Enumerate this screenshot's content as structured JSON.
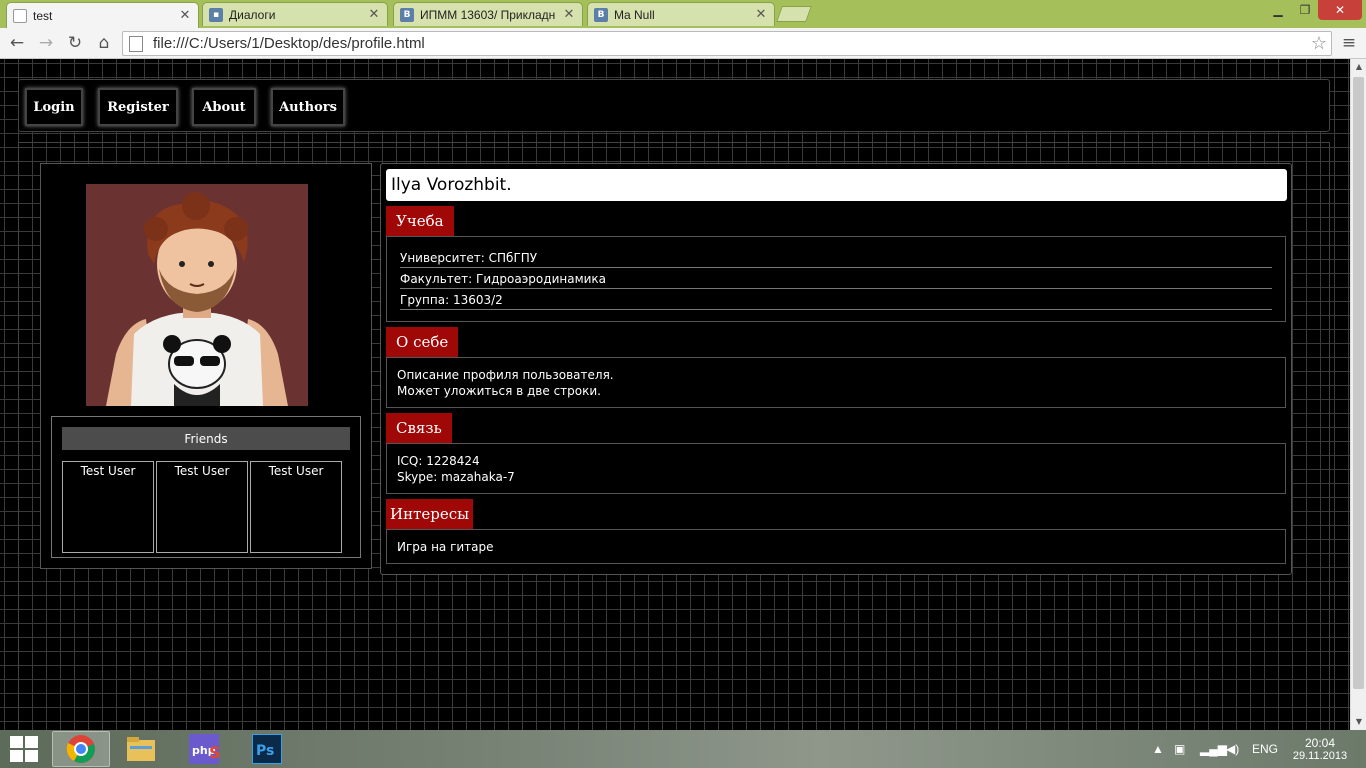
{
  "browser": {
    "tabs": [
      {
        "title": "test",
        "active": true
      },
      {
        "title": "Диалоги",
        "active": false
      },
      {
        "title": "ИПММ 13603/ Прикладн",
        "active": false
      },
      {
        "title": "Ma Null",
        "active": false
      }
    ],
    "address": "file:///C:/Users/1/Desktop/des/profile.html"
  },
  "nav": {
    "buttons": [
      "Login",
      "Register",
      "About",
      "Authors"
    ]
  },
  "profile": {
    "name": "Ilya Vorozhbit.",
    "friends_title": "Friends",
    "friends": [
      "Test User",
      "Test User",
      "Test User"
    ],
    "sections": {
      "study": {
        "title": "Учеба",
        "lines": [
          "Университет: СПбГПУ",
          "Факультет: Гидроаэродинамика",
          "Группа: 13603/2"
        ]
      },
      "about": {
        "title": "О себе",
        "lines": [
          "Описание профиля пользователя.",
          "Может уложиться в две строки."
        ]
      },
      "contact": {
        "title": "Связь",
        "lines": [
          "ICQ: 1228424",
          "Skype: mazahaka-7"
        ]
      },
      "interests": {
        "title": "Интересы",
        "lines": [
          "Игра на гитаре"
        ]
      }
    }
  },
  "taskbar": {
    "lang": "ENG",
    "time": "20:04",
    "date": "29.11.2013"
  },
  "colors": {
    "section_red": "#a00707",
    "tabbar_green": "#a5c05a"
  }
}
